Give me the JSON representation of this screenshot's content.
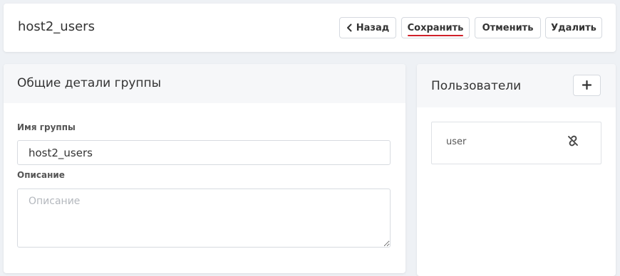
{
  "header": {
    "title": "host2_users",
    "buttons": {
      "back": "Назад",
      "save": "Сохранить",
      "cancel": "Отменить",
      "delete": "Удалить"
    }
  },
  "group_details": {
    "title": "Общие детали группы",
    "name_label": "Имя группы",
    "name_value": "host2_users",
    "description_label": "Описание",
    "description_placeholder": "Описание",
    "description_value": ""
  },
  "users": {
    "title": "Пользователи",
    "items": [
      {
        "name": "user"
      }
    ]
  },
  "icons": {
    "back": "chevron-left-icon",
    "add": "plus-icon",
    "unlink": "unlink-icon"
  },
  "colors": {
    "save_underline": "#d0202a",
    "page_background": "#eef1f5"
  }
}
